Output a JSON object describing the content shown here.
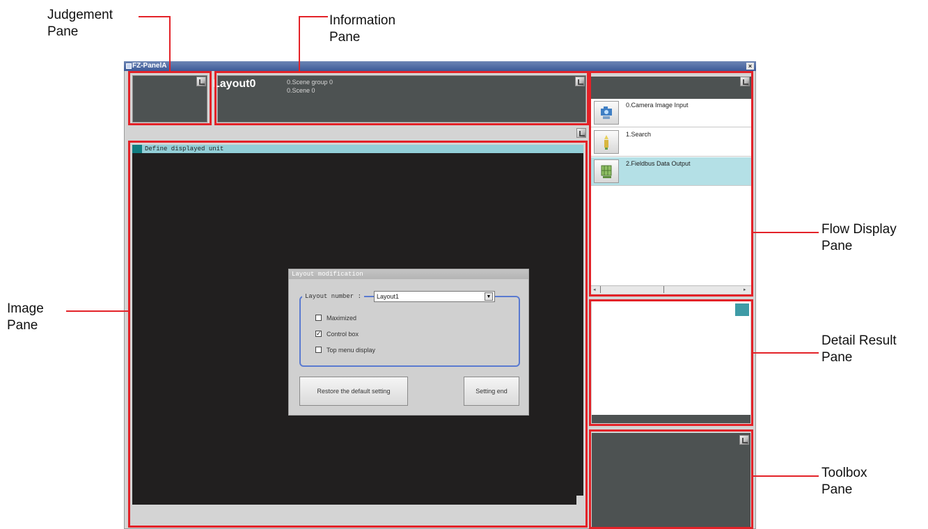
{
  "window": {
    "title": "FZ-PanelA",
    "close_label": "×"
  },
  "callouts": {
    "judgement": "Judgement\nPane",
    "information": "Information\nPane",
    "image": "Image\nPane",
    "flow_display": "Flow Display\nPane",
    "detail_result": "Detail Result\nPane",
    "toolbox": "Toolbox\nPane"
  },
  "information_pane": {
    "layout_title": "Layout0",
    "scene_group": "0.Scene group 0",
    "scene": "0.Scene 0"
  },
  "image_pane": {
    "header": "Define displayed unit"
  },
  "dialog": {
    "title": "Layout modification",
    "layout_number_label": "Layout number :",
    "layout_number_value": "Layout1",
    "checkboxes": [
      {
        "label": "Maximized",
        "checked": false
      },
      {
        "label": "Control box",
        "checked": true
      },
      {
        "label": "Top menu display",
        "checked": false
      }
    ],
    "restore_button": "Restore the default setting",
    "setting_end_button": "Setting end"
  },
  "flow": {
    "items": [
      {
        "label": "0.Camera Image Input",
        "icon": "camera-icon",
        "selected": false
      },
      {
        "label": "1.Search",
        "icon": "search-tool-icon",
        "selected": false
      },
      {
        "label": "2.Fieldbus Data Output",
        "icon": "data-output-icon",
        "selected": true
      }
    ]
  },
  "colors": {
    "callout_red": "#e32228",
    "pane_dark": "#4d5252",
    "image_black": "#211f1f",
    "header_cyan": "#93cfd8",
    "selected_cyan": "#b4e0e6"
  }
}
